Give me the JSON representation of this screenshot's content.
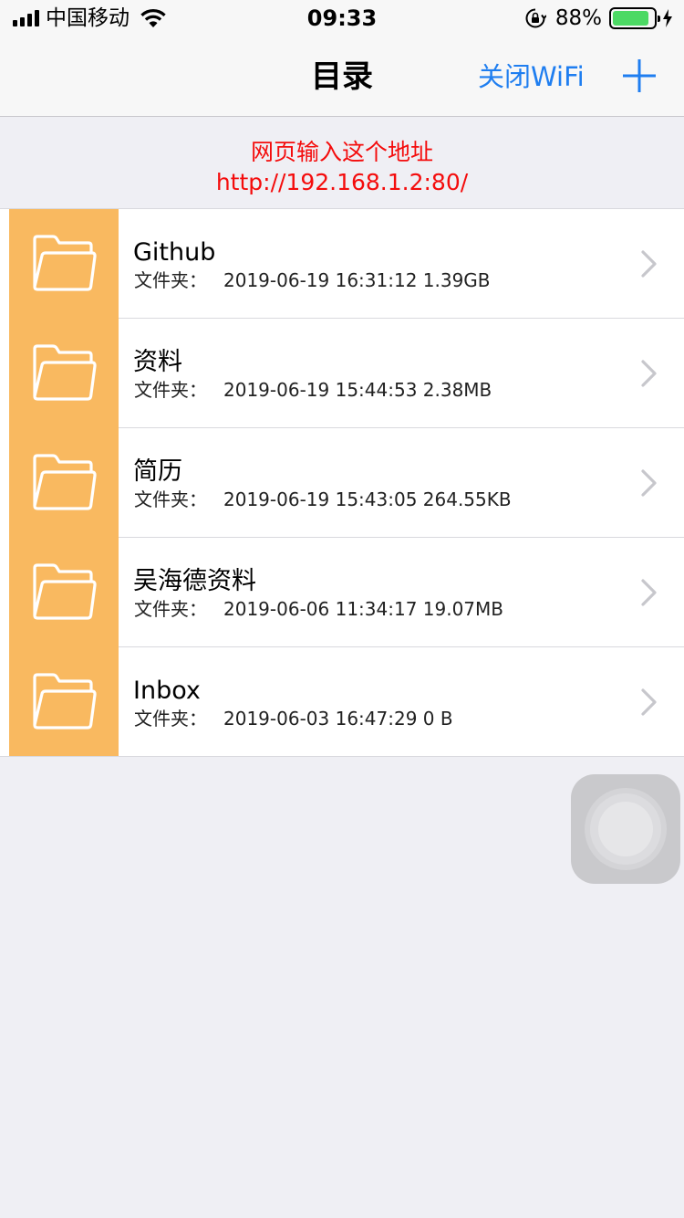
{
  "status_bar": {
    "carrier": "中国移动",
    "time": "09:33",
    "battery_percent": "88%",
    "battery_level": 0.88,
    "icons": [
      "signal-icon",
      "wifi-icon",
      "orientation-lock-icon",
      "battery-icon",
      "charging-bolt-icon"
    ]
  },
  "nav": {
    "title": "目录",
    "wifi_button": "关闭WiFi",
    "add_icon": "plus-icon"
  },
  "banner": {
    "line1": "网页输入这个地址",
    "line2": "http://192.168.1.2:80/"
  },
  "files": [
    {
      "name": "Github",
      "kind": "文件夹：",
      "info": "2019-06-19 16:31:12 1.39GB"
    },
    {
      "name": "资料",
      "kind": "文件夹：",
      "info": "2019-06-19 15:44:53 2.38MB"
    },
    {
      "name": "简历",
      "kind": "文件夹：",
      "info": "2019-06-19 15:43:05 264.55KB"
    },
    {
      "name": "吴海德资料",
      "kind": "文件夹：",
      "info": "2019-06-06 11:34:17 19.07MB"
    },
    {
      "name": "Inbox",
      "kind": "文件夹：",
      "info": "2019-06-03 16:47:29 0 B"
    }
  ],
  "colors": {
    "accent": "#1f7ef0",
    "address_text": "#f40c0c",
    "folder_tile": "#f9b960",
    "battery_fill": "#4cd964",
    "background": "#efeff4"
  }
}
